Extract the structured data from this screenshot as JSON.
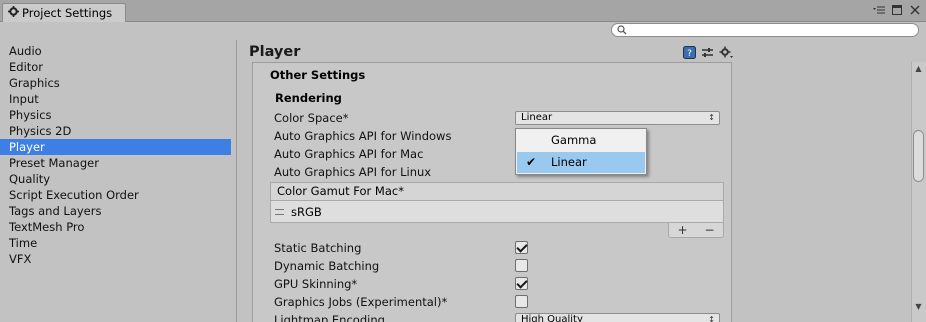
{
  "window": {
    "tab_title": "Project Settings",
    "controls": [
      "menu-icon",
      "maximize-icon",
      "close-icon"
    ]
  },
  "search": {
    "placeholder": ""
  },
  "sidebar": {
    "items": [
      {
        "label": "Audio"
      },
      {
        "label": "Editor"
      },
      {
        "label": "Graphics"
      },
      {
        "label": "Input"
      },
      {
        "label": "Physics"
      },
      {
        "label": "Physics 2D"
      },
      {
        "label": "Player",
        "selected": true
      },
      {
        "label": "Preset Manager"
      },
      {
        "label": "Quality"
      },
      {
        "label": "Script Execution Order"
      },
      {
        "label": "Tags and Layers"
      },
      {
        "label": "TextMesh Pro"
      },
      {
        "label": "Time"
      },
      {
        "label": "VFX"
      }
    ]
  },
  "main": {
    "title": "Player",
    "section_title": "Other Settings",
    "subsection_title": "Rendering",
    "color_space": {
      "label": "Color Space*",
      "value": "Linear"
    },
    "auto_api_windows": "Auto Graphics API  for Windows",
    "auto_api_mac": "Auto Graphics API  for Mac",
    "auto_api_linux": "Auto Graphics API  for Linux",
    "color_gamut": {
      "label": "Color Gamut For Mac*",
      "item": "sRGB",
      "add": "+",
      "remove": "−"
    },
    "static_batching": {
      "label": "Static Batching",
      "checked": true
    },
    "dynamic_batching": {
      "label": "Dynamic Batching",
      "checked": false
    },
    "gpu_skinning": {
      "label": "GPU Skinning*",
      "checked": true
    },
    "graphics_jobs": {
      "label": "Graphics Jobs (Experimental)*",
      "checked": false
    },
    "lightmap_encoding": {
      "label": "Lightmap Encoding",
      "value": "High Quality"
    }
  },
  "popup_menu": {
    "items": [
      {
        "label": "Gamma",
        "selected": false
      },
      {
        "label": "Linear",
        "selected": true
      }
    ]
  },
  "colors": {
    "selection": "#3d7fe4",
    "menu_highlight": "#99c9ef",
    "background": "#c2c2c2"
  }
}
